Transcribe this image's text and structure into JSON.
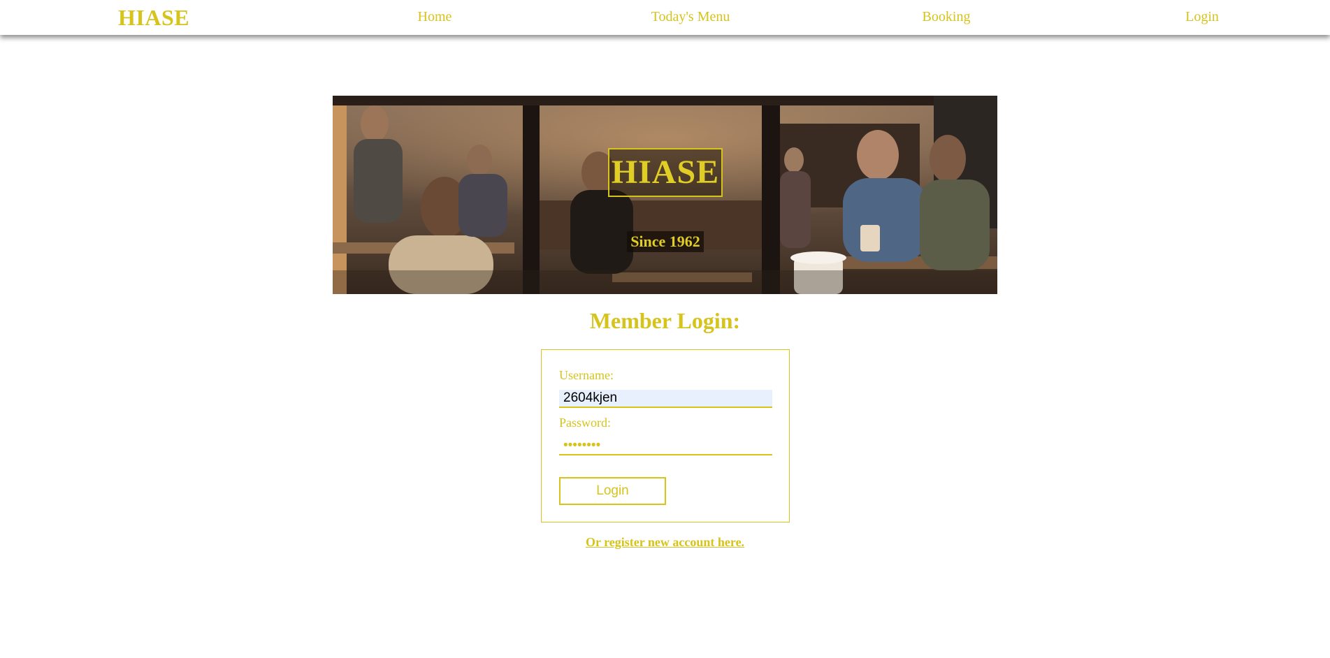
{
  "nav": {
    "brand": "HIASE",
    "items": [
      {
        "label": "Home"
      },
      {
        "label": "Today's Menu"
      },
      {
        "label": "Booking"
      },
      {
        "label": "Login"
      }
    ]
  },
  "banner": {
    "logo_text": "HIASE",
    "tagline": "Since 1962"
  },
  "login": {
    "title": "Member Login:",
    "username_label": "Username:",
    "username_value": "2604kjen",
    "password_label": "Password:",
    "password_value": "••••••••",
    "button_label": "Login"
  },
  "register": {
    "link_text": "Or register new account here."
  },
  "colors": {
    "accent": "#d6c31c",
    "autofill_bg": "#e8f0fe",
    "background": "#ffffff"
  }
}
